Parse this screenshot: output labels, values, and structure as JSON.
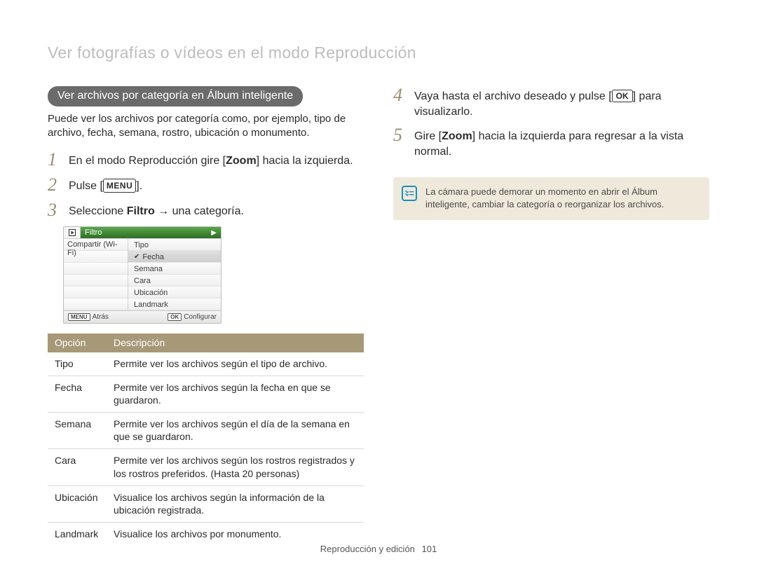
{
  "header": {
    "title": "Ver fotografías o vídeos en el modo Reproducción"
  },
  "left": {
    "pill": "Ver archivos por categoría en Álbum inteligente",
    "intro": "Puede ver los archivos por categoría como, por ejemplo, tipo de archivo, fecha, semana, rostro, ubicación o monumento.",
    "step1_a": "En el modo Reproducción gire [",
    "step1_b": "Zoom",
    "step1_c": "] hacia la izquierda.",
    "step2_a": "Pulse [",
    "step2_key": "MENU",
    "step2_b": "].",
    "step3_a": "Seleccione ",
    "step3_b": "Filtro",
    "step3_c": " → una categoría.",
    "camera": {
      "filtro": "Filtro",
      "left_items": [
        "Compartir (Wi-Fi)"
      ],
      "right_items": [
        "Tipo",
        "Fecha",
        "Semana",
        "Cara",
        "Ubicación",
        "Landmark"
      ],
      "selected_index": 1,
      "back_key": "MENU",
      "back": "Atrás",
      "ok_key": "OK",
      "ok": "Configurar"
    },
    "table": {
      "headers": [
        "Opción",
        "Descripción"
      ],
      "rows": [
        {
          "opt": "Tipo",
          "desc": "Permite ver los archivos según el tipo de archivo."
        },
        {
          "opt": "Fecha",
          "desc": "Permite ver los archivos según la fecha en que se guardaron."
        },
        {
          "opt": "Semana",
          "desc": "Permite ver los archivos según el día de la semana en que se guardaron."
        },
        {
          "opt": "Cara",
          "desc": "Permite ver los archivos según los rostros registrados y los rostros preferidos. (Hasta 20 personas)"
        },
        {
          "opt": "Ubicación",
          "desc": "Visualice los archivos según la información de la ubicación registrada."
        },
        {
          "opt": "Landmark",
          "desc": "Visualice los archivos por monumento."
        }
      ]
    }
  },
  "right": {
    "step4_a": "Vaya hasta el archivo deseado y pulse [",
    "step4_key": "OK",
    "step4_b": "] para visualizarlo.",
    "step5_a": "Gire [",
    "step5_b": "Zoom",
    "step5_c": "] hacia la izquierda para regresar a la vista normal.",
    "note": "La cámara puede demorar un momento en abrir el Álbum inteligente, cambiar la categoría o reorganizar los archivos."
  },
  "footer": {
    "section": "Reproducción y edición",
    "page": "101"
  }
}
